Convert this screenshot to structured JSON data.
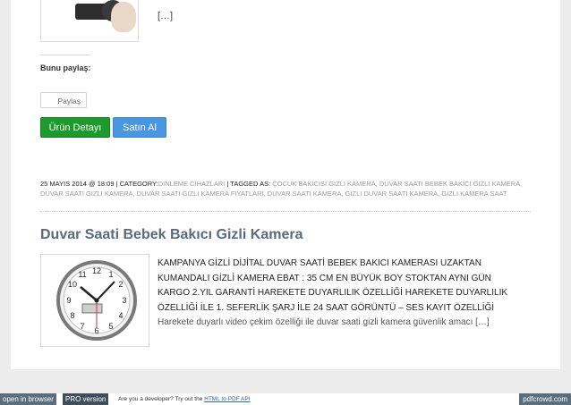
{
  "post_top": {
    "ellipsis": "[…]",
    "share_label": "Bunu paylaş:",
    "share_button": "Paylaş",
    "detail_button": "Ürün Detayı",
    "buy_button": "Satın Al"
  },
  "meta": {
    "date_prefix": "25 MAYIS 2014 @ 18:09 | CATEGORY:",
    "category": "DINLEME CIHAZLARI",
    "tagged_prefix": " | TAGGED AS: ",
    "tags": "ÇOCUK BAKICISI GIZLI KAMERA, DUVAR SAATI BEBEK BAKICI GIZLI KAMERA, DUVAR SAATI GIZLI KAMERA, DUVAR SAATI GIZLI KAMERA FIYATLARI, DUVAR SAATI KAMERA, GIZLI DUVAR SAATI KAMERA, GIZLI KAMERA SAAT"
  },
  "post": {
    "title": "Duvar Saati Bebek Bakıcı Gizli Kamera",
    "excerpt_lines": [
      "KAMPANYA GİZLİ DİJİTAL DUVAR SAATİ BEBEK BAKICI KAMERASI UZAKTAN",
      "KUMANDALI GİZLİ KAMERA EBAT : 35 CM EN BÜYÜK BOY  STOKTAN AYNI GÜN",
      "KARGO 2.YIL GARANTİ HAREKETE DUYARLILIK ÖZELLİĞİ HAREKETE DUYARLILIK",
      "ÖZELLİĞİ İLE 1. SEFERLİK ŞARJ İLE 24 SAAT GÖRÜNTÜ – SES KAYIT ÖZELLİĞİ",
      "Harekete duyarlı video çekim özelliği ile duvar saati gizli kamera  güvenlik amacı […]"
    ]
  },
  "footer": {
    "open_browser": "open in browser",
    "pro": "PRO version",
    "dev_text": "Are you a developer? Try out the ",
    "api_link": "HTML to PDF API",
    "brand": "pdfcrowd.com"
  }
}
